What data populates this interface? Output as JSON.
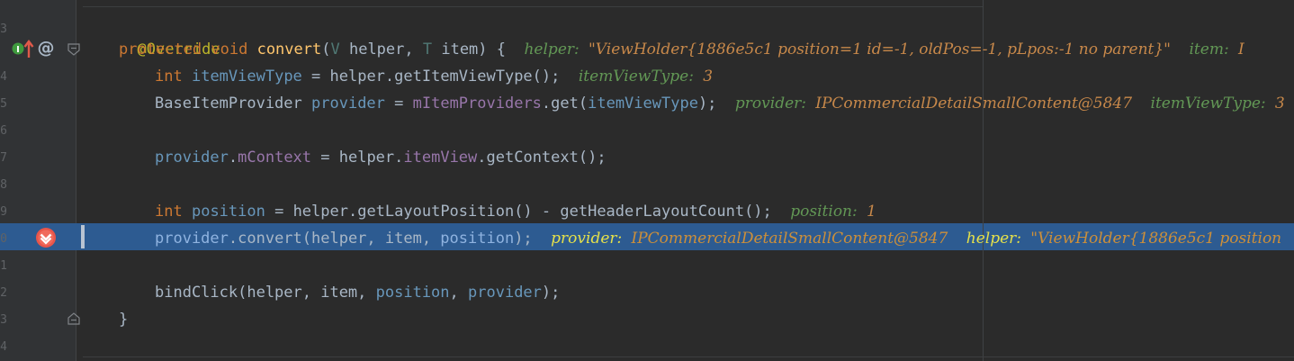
{
  "gutter": {
    "line_numbers": [
      "",
      "3",
      "4",
      "5",
      "6",
      "7",
      "8",
      "9",
      "0",
      "1",
      "2",
      "3",
      "4"
    ]
  },
  "code": {
    "override": "@Override",
    "l3": {
      "kw1": "protected",
      "kw2": "void",
      "method": "convert",
      "paren": "(",
      "type1": "V",
      "p1": " helper, ",
      "type2": "T",
      "p2": " item) {",
      "h1n": "helper:",
      "h1v": "\"ViewHolder{1886e5c1 position=1 id=-1, oldPos=-1, pLpos:-1 no parent}\"",
      "h2n": "item:",
      "h2v": "I"
    },
    "l4": {
      "kw": "int",
      "var": "itemViewType",
      "rest": " = helper.getItemViewType();",
      "hn": "itemViewType:",
      "hv": "3"
    },
    "l5": {
      "type": "BaseItemProvider",
      "var": "provider",
      "eq": " = ",
      "field": "mItemProviders",
      "call": ".get(",
      "arg": "itemViewType",
      "end": ");",
      "h1n": "provider:",
      "h1v": "IPCommercialDetailSmallContent@5847",
      "h2n": "itemViewType:",
      "h2v": "3"
    },
    "l7": {
      "var": "provider",
      "dot": ".",
      "field": "mContext",
      "eq": " = helper.",
      "field2": "itemView",
      "rest": ".getContext();"
    },
    "l9": {
      "kw": "int",
      "var": "position",
      "rest": " = helper.getLayoutPosition() - getHeaderLayoutCount();",
      "hn": "position:",
      "hv": "1"
    },
    "l10": {
      "var": "provider",
      "call": ".convert(helper, item, ",
      "arg": "position",
      "end": ");",
      "h1n": "provider:",
      "h1v": "IPCommercialDetailSmallContent@5847",
      "h2n": "helper:",
      "h2v": "\"ViewHolder{1886e5c1 position"
    },
    "l12": {
      "call": "bindClick(helper, item, ",
      "a1": "position",
      "sep": ", ",
      "a2": "provider",
      "end": ");"
    },
    "close": "}"
  },
  "icons": {
    "implements": "implements-arrow-icon",
    "annotation": "at-sign-icon",
    "breakpoint": "breakpoint-icon",
    "fold": "fold-icon"
  },
  "colors": {
    "background": "#2b2b2b",
    "gutter": "#313335",
    "selection": "#2d5b91",
    "keyword": "#cc7832",
    "annotation": "#bbb529",
    "method": "#ffc66d",
    "field": "#9876aa",
    "hint_name": "#629755",
    "hint_value": "#c7884a"
  }
}
